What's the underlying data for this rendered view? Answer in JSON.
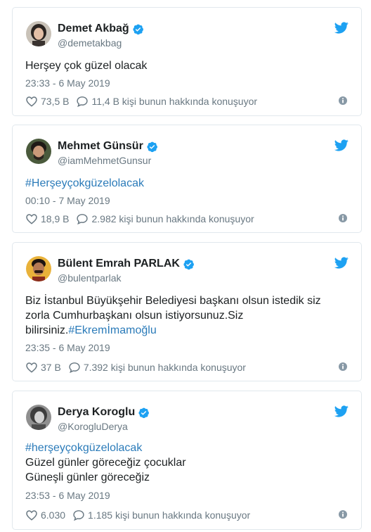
{
  "tweets": [
    {
      "name": "Demet Akbağ",
      "handle": "@demetakbag",
      "text": [
        {
          "type": "plain",
          "text": "Herşey çok güzel olacak"
        }
      ],
      "timestamp": "23:33 - 6 May 2019",
      "likes": "73,5 B",
      "replies": "11,4 B kişi bunun hakkında konuşuyor"
    },
    {
      "name": "Mehmet Günsür",
      "handle": "@iamMehmetGunsur",
      "text": [
        {
          "type": "hashtag",
          "text": "#Herşeyçokgüzelolacak"
        }
      ],
      "timestamp": "00:10 - 7 May 2019",
      "likes": "18,9 B",
      "replies": "2.982 kişi bunun hakkında konuşuyor"
    },
    {
      "name": "Bülent Emrah PARLAK",
      "handle": "@bulentparlak",
      "text": [
        {
          "type": "plain",
          "text": "Biz İstanbul Büyükşehir Belediyesi başkanı olsun istedik siz"
        },
        {
          "type": "plain",
          "text": "zorla Cumhurbaşkanı olsun istiyorsunuz.Siz"
        },
        {
          "type": "mixed",
          "plain": "bilirsiniz.",
          "hashtag": "#Ekremİmamoğlu"
        }
      ],
      "timestamp": "23:35 - 6 May 2019",
      "likes": "37 B",
      "replies": "7.392 kişi bunun hakkında konuşuyor"
    },
    {
      "name": "Derya Koroglu",
      "handle": "@KorogluDerya",
      "text": [
        {
          "type": "hashtag",
          "text": "#herşeyçokgüzelolacak"
        },
        {
          "type": "plain",
          "text": "Güzel günler göreceğiz çocuklar"
        },
        {
          "type": "plain",
          "text": "Güneşli günler göreceğiz"
        }
      ],
      "timestamp": "23:53 - 6 May 2019",
      "likes": "6.030",
      "replies": "1.185 kişi bunun hakkında konuşuyor"
    }
  ],
  "icons": {
    "like": "heart-icon",
    "reply": "speech-bubble-icon",
    "info": "info-icon",
    "brand": "twitter-bird-icon",
    "verified": "verified-badge-icon"
  },
  "colors": {
    "twitter_blue": "#1da1f2",
    "hashtag": "#2b7bb9",
    "secondary_text": "#697882",
    "border": "#e1e8ed"
  }
}
